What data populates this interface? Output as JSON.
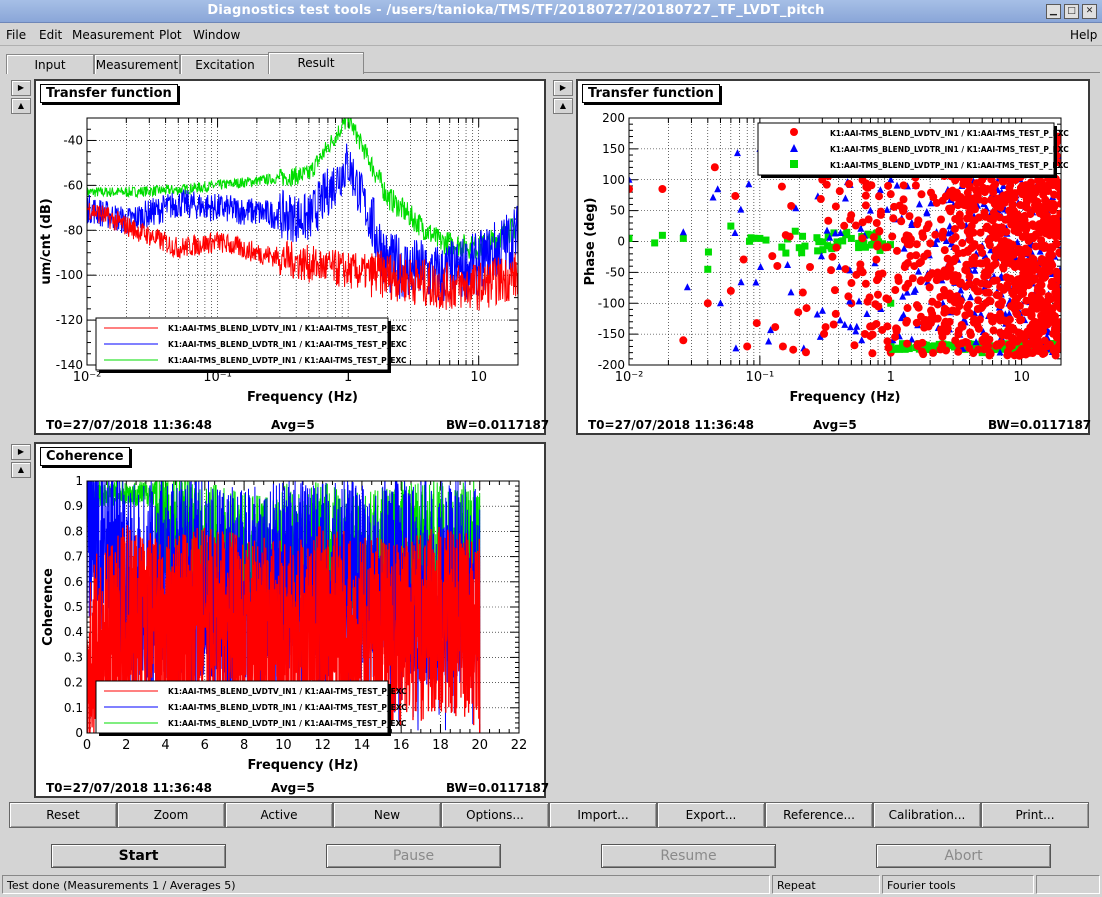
{
  "window": {
    "title": "Diagnostics test tools - /users/tanioka/TMS/TF/20180727/20180727_TF_LVDT_pitch"
  },
  "menu": [
    "File",
    "Edit",
    "Measurement",
    "Plot",
    "Window"
  ],
  "help_label": "Help",
  "tabs": [
    "Input",
    "Measurement",
    "Excitation",
    "Result"
  ],
  "colors": {
    "red": "#ff0000",
    "blue": "#0000ff",
    "green": "#00dd00"
  },
  "legend": [
    "K1:AAI-TMS_BLEND_LVDTV_IN1 / K1:AAI-TMS_TEST_P_EXC",
    "K1:AAI-TMS_BLEND_LVDTR_IN1 / K1:AAI-TMS_TEST_P_EXC",
    "K1:AAI-TMS_BLEND_LVDTP_IN1 / K1:AAI-TMS_TEST_P_EXC"
  ],
  "panels": {
    "mag": {
      "title": "Transfer function",
      "t0": "T0=27/07/2018 11:36:48",
      "avg": "Avg=5",
      "bw": "BW=0.0117187"
    },
    "phase": {
      "title": "Transfer function",
      "t0": "T0=27/07/2018 11:36:48",
      "avg": "Avg=5",
      "bw": "BW=0.0117187"
    },
    "coh": {
      "title": "Coherence",
      "t0": "T0=27/07/2018 11:36:48",
      "avg": "Avg=5",
      "bw": "BW=0.0117187"
    }
  },
  "chart_data": [
    {
      "type": "line",
      "title": "Transfer function",
      "xlabel": "Frequency (Hz)",
      "ylabel": "um/cnt (dB)",
      "xscale": "log",
      "xlim": [
        0.01,
        20
      ],
      "ylim": [
        -140,
        -30
      ],
      "xticks": [
        "10⁻²",
        "10⁻¹",
        "1",
        "10"
      ],
      "yticks": [
        "-40",
        "-60",
        "-80",
        "-100",
        "-120",
        "-140"
      ],
      "grid": true,
      "legend_position": "bottom-left",
      "series": [
        {
          "name": "K1:AAI-TMS_BLEND_LVDTV_IN1 / K1:AAI-TMS_TEST_P_EXC",
          "x": [
            0.01,
            0.02,
            0.05,
            0.1,
            0.2,
            0.5,
            1,
            2,
            5,
            10,
            20
          ],
          "y": [
            -70,
            -78,
            -88,
            -85,
            -90,
            -95,
            -98,
            -100,
            -105,
            -105,
            -100
          ]
        },
        {
          "name": "K1:AAI-TMS_BLEND_LVDTR_IN1 / K1:AAI-TMS_TEST_P_EXC",
          "x": [
            0.01,
            0.02,
            0.05,
            0.1,
            0.2,
            0.5,
            1,
            2,
            5,
            10,
            20
          ],
          "y": [
            -70,
            -76,
            -68,
            -70,
            -72,
            -75,
            -50,
            -95,
            -100,
            -95,
            -82
          ]
        },
        {
          "name": "K1:AAI-TMS_BLEND_LVDTP_IN1 / K1:AAI-TMS_TEST_P_EXC",
          "x": [
            0.01,
            0.02,
            0.05,
            0.1,
            0.2,
            0.5,
            1,
            2,
            5,
            10,
            20
          ],
          "y": [
            -63,
            -63,
            -62,
            -60,
            -58,
            -55,
            -30,
            -65,
            -85,
            -88,
            -78
          ]
        }
      ]
    },
    {
      "type": "scatter",
      "title": "Transfer function",
      "xlabel": "Frequency (Hz)",
      "ylabel": "Phase (deg)",
      "xscale": "log",
      "xlim": [
        0.01,
        20
      ],
      "ylim": [
        -200,
        200
      ],
      "xticks": [
        "10⁻²",
        "10⁻¹",
        "1",
        "10"
      ],
      "yticks": [
        "200",
        "150",
        "100",
        "50",
        "0",
        "-50",
        "-100",
        "-150",
        "-200"
      ],
      "grid": true,
      "legend_position": "top-right",
      "series": [
        {
          "name": "K1:AAI-TMS_BLEND_LVDTV_IN1 / K1:AAI-TMS_TEST_P_EXC",
          "marker": "circle",
          "x": [
            0.01,
            0.018,
            0.026,
            0.04,
            0.06,
            0.08,
            0.15,
            0.3,
            0.5,
            1,
            2,
            5,
            10
          ],
          "y": [
            85,
            85,
            -160,
            -100,
            -80,
            -170,
            -170,
            100,
            -100,
            -180,
            150,
            100,
            -150
          ]
        },
        {
          "name": "K1:AAI-TMS_BLEND_LVDTR_IN1 / K1:AAI-TMS_TEST_P_EXC",
          "marker": "triangle",
          "x": [
            0.01,
            0.026,
            0.05,
            0.1,
            0.15,
            0.3,
            0.6,
            1,
            2,
            5
          ],
          "y": [
            100,
            15,
            -100,
            150,
            -170,
            150,
            -160,
            100,
            -50,
            150
          ]
        },
        {
          "name": "K1:AAI-TMS_BLEND_LVDTP_IN1 / K1:AAI-TMS_TEST_P_EXC",
          "marker": "square",
          "x": [
            0.01,
            0.018,
            0.026,
            0.04,
            0.06,
            0.1,
            0.2,
            0.5,
            1,
            2,
            5
          ],
          "y": [
            5,
            10,
            5,
            -45,
            25,
            5,
            -10,
            5,
            -100,
            -175,
            -180
          ]
        }
      ]
    },
    {
      "type": "line",
      "title": "Coherence",
      "xlabel": "Frequency (Hz)",
      "ylabel": "Coherence",
      "xlim": [
        0,
        22
      ],
      "ylim": [
        0,
        1
      ],
      "xticks": [
        "0",
        "2",
        "4",
        "6",
        "8",
        "10",
        "12",
        "14",
        "16",
        "18",
        "20",
        "22"
      ],
      "yticks": [
        "1",
        "0.9",
        "0.8",
        "0.7",
        "0.6",
        "0.5",
        "0.4",
        "0.3",
        "0.2",
        "0.1",
        "0"
      ],
      "grid": true,
      "legend_position": "bottom-left",
      "series": [
        {
          "name": "K1:AAI-TMS_BLEND_LVDTV_IN1 / K1:AAI-TMS_TEST_P_EXC",
          "x": [
            0,
            2,
            4,
            6,
            8,
            10,
            12,
            14,
            16,
            18,
            20
          ],
          "y": [
            0.3,
            0.45,
            0.4,
            0.45,
            0.4,
            0.4,
            0.45,
            0.4,
            0.4,
            0.45,
            0.4
          ]
        },
        {
          "name": "K1:AAI-TMS_BLEND_LVDTR_IN1 / K1:AAI-TMS_TEST_P_EXC",
          "x": [
            0,
            2,
            4,
            6,
            8,
            10,
            12,
            14,
            16,
            18,
            20
          ],
          "y": [
            0.9,
            0.6,
            0.6,
            0.6,
            0.55,
            0.6,
            0.6,
            0.6,
            0.6,
            0.6,
            0.6
          ]
        },
        {
          "name": "K1:AAI-TMS_BLEND_LVDTP_IN1 / K1:AAI-TMS_TEST_P_EXC",
          "x": [
            0,
            2,
            4,
            6,
            8,
            10,
            12,
            14,
            16,
            18,
            20
          ],
          "y": [
            1.0,
            0.95,
            0.8,
            0.7,
            0.65,
            0.7,
            0.7,
            0.65,
            0.7,
            0.7,
            0.7
          ]
        }
      ]
    }
  ],
  "toolbar": [
    "Reset",
    "Zoom",
    "Active",
    "New",
    "Options...",
    "Import...",
    "Export...",
    "Reference...",
    "Calibration...",
    "Print..."
  ],
  "actions": {
    "start": "Start",
    "pause": "Pause",
    "resume": "Resume",
    "abort": "Abort"
  },
  "status": {
    "message": "Test done (Measurements 1 / Averages 5)",
    "mode": "Repeat",
    "tool": "Fourier tools"
  }
}
